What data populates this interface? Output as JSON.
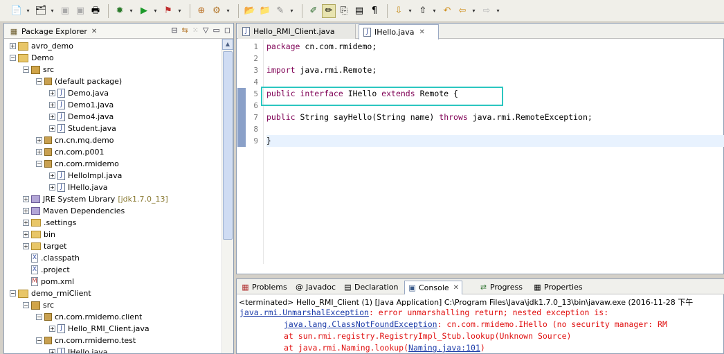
{
  "toolbar": {
    "buttons": [
      "new-wizard",
      "new-dropdown",
      "open-type",
      "save",
      "save-all",
      "print",
      "debug",
      "run",
      "run-external",
      "open-perspective",
      "search",
      "open-task",
      "highlight",
      "show-whitespace",
      "toggle-mark-occurrences",
      "next-annotation",
      "prev-annotation",
      "last-edit",
      "back",
      "forward"
    ]
  },
  "explorer": {
    "title": "Package Explorer",
    "items": [
      {
        "label": "avro_demo",
        "extra": ""
      },
      {
        "label": "Demo",
        "extra": ""
      },
      {
        "label": "src",
        "extra": ""
      },
      {
        "label": "(default package)",
        "extra": ""
      },
      {
        "label": "Demo.java",
        "extra": ""
      },
      {
        "label": "Demo1.java",
        "extra": ""
      },
      {
        "label": "Demo4.java",
        "extra": ""
      },
      {
        "label": "Student.java",
        "extra": ""
      },
      {
        "label": "cn.cn.mq.demo",
        "extra": ""
      },
      {
        "label": "cn.com.p001",
        "extra": ""
      },
      {
        "label": "cn.com.rmidemo",
        "extra": ""
      },
      {
        "label": "HelloImpl.java",
        "extra": ""
      },
      {
        "label": "IHello.java",
        "extra": ""
      },
      {
        "label": "JRE System Library",
        "extra": "[jdk1.7.0_13]"
      },
      {
        "label": "Maven Dependencies",
        "extra": ""
      },
      {
        "label": ".settings",
        "extra": ""
      },
      {
        "label": "bin",
        "extra": ""
      },
      {
        "label": "target",
        "extra": ""
      },
      {
        "label": ".classpath",
        "extra": ""
      },
      {
        "label": ".project",
        "extra": ""
      },
      {
        "label": "pom.xml",
        "extra": ""
      },
      {
        "label": "demo_rmiClient",
        "extra": ""
      },
      {
        "label": "src",
        "extra": ""
      },
      {
        "label": "cn.com.rmidemo.client",
        "extra": ""
      },
      {
        "label": "Hello_RMI_Client.java",
        "extra": ""
      },
      {
        "label": "cn.com.rmidemo.test",
        "extra": ""
      },
      {
        "label": "IHello.java",
        "extra": ""
      }
    ]
  },
  "editor": {
    "tabs": [
      {
        "label": "Hello_RMI_Client.java",
        "active": false
      },
      {
        "label": "IHello.java",
        "active": true
      }
    ],
    "line_numbers": [
      "1",
      "2",
      "3",
      "4",
      "5",
      "6",
      "7",
      "8",
      "9"
    ],
    "lines": [
      {
        "kw": "package",
        "rest": " cn.com.rmidemo;"
      },
      {
        "kw": "",
        "rest": ""
      },
      {
        "kw": "import",
        "rest": " java.rmi.Remote;"
      },
      {
        "kw": "",
        "rest": ""
      },
      {
        "kw": "public interface",
        "rest": " IHello ",
        "kw2": "extends",
        "rest2": " Remote {"
      },
      {
        "kw": "",
        "rest": ""
      },
      {
        "kw": "public",
        "rest": " String sayHello(String name) ",
        "kw2": "throws",
        "rest2": " java.rmi.RemoteException;"
      },
      {
        "kw": "",
        "rest": ""
      },
      {
        "kw": "",
        "rest": "}"
      }
    ]
  },
  "bottom": {
    "tabs": [
      "Problems",
      "Javadoc",
      "Declaration",
      "Console",
      "Progress",
      "Properties"
    ],
    "active_tab": "Console",
    "console_header": "<terminated> Hello_RMI_Client (1) [Java Application] C:\\Program Files\\Java\\jdk1.7.0_13\\bin\\javaw.exe (2016-11-28 下午",
    "console_lines": [
      {
        "link": "java.rmi.UnmarshalException",
        "text": ": error unmarshalling return; nested exception is:",
        "indent": ""
      },
      {
        "link": "java.lang.ClassNotFoundException",
        "text": ": cn.com.rmidemo.IHello (no security manager: RM",
        "indent": "\t"
      },
      {
        "link": "",
        "text": "at sun.rmi.registry.RegistryImpl_Stub.lookup(Unknown Source)",
        "indent": "\t"
      },
      {
        "link": "Naming.java:101",
        "text": "at java.rmi.Naming.lookup(",
        "suffix": ")",
        "indent": "\t"
      }
    ]
  },
  "colors": {
    "keyword": "#7f0055",
    "error": "#e01010",
    "link": "#1a3aa8",
    "selection_box": "#2bc6c0",
    "current_line": "#e8f2fe"
  }
}
